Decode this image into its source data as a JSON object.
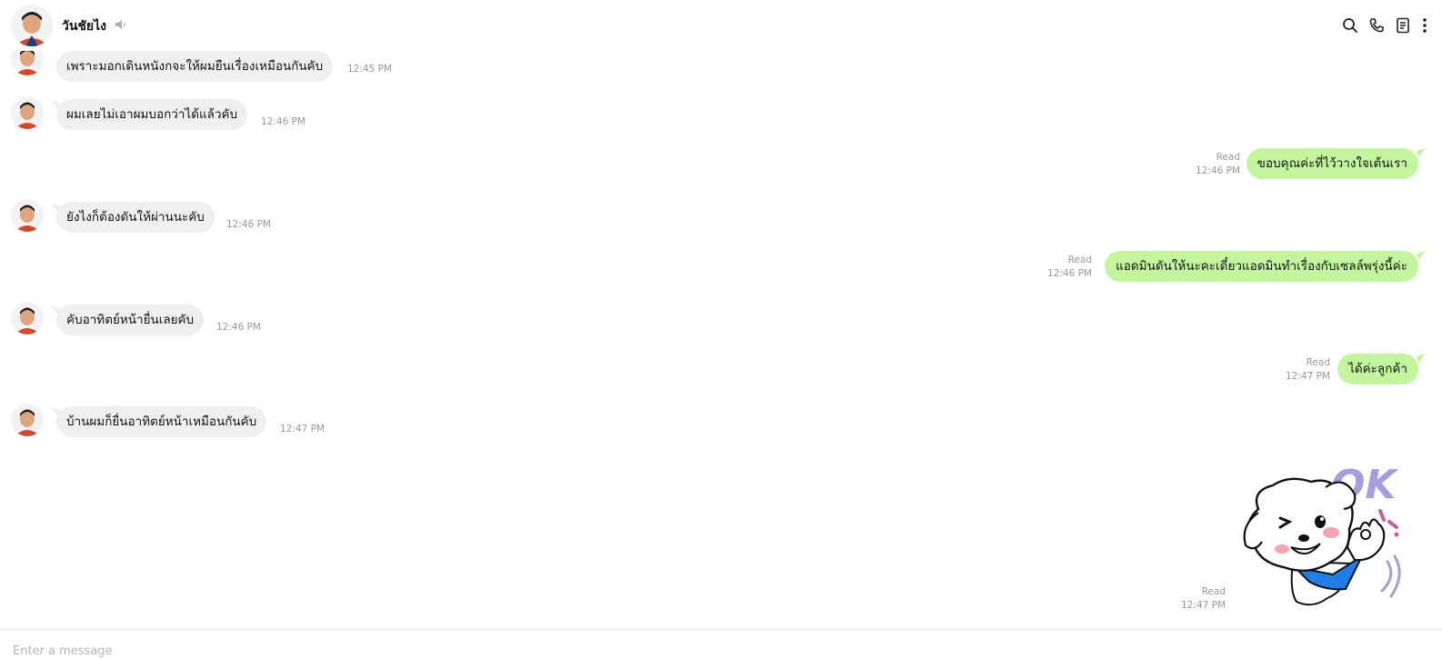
{
  "header": {
    "contact_name": "วันชัยไง",
    "icons": [
      "search-icon",
      "phone-icon",
      "notes-icon",
      "more-icon"
    ]
  },
  "messages": [
    {
      "side": "in",
      "text": "เพราะมอกเดินหนังกจะให้ผมยืนเรื่องเหมือนกันคับ",
      "time": "12:45 PM"
    },
    {
      "side": "in",
      "text": "ผมเลยไม่เอาผมบอกว่าได้แล้วคับ",
      "time": "12:46 PM"
    },
    {
      "side": "out",
      "text": "ขอบคุณค่ะที่ไว้วางใจเต้นเรา",
      "status": "Read",
      "time": "12:46 PM"
    },
    {
      "side": "in",
      "text": "ยังไงก็ต้องดันให้ผ่านนะคับ",
      "time": "12:46 PM"
    },
    {
      "side": "out",
      "text": "แอดมินดันให้นะคะเดี๋ยวแอดมินทำเรื่องกับเซลล์พรุ่งนี้ค่ะ",
      "status": "Read",
      "time": "12:46 PM"
    },
    {
      "side": "in",
      "text": "คับอาทิตย์หน้ายื่นเลยคับ",
      "time": "12:46 PM"
    },
    {
      "side": "out",
      "text": "ได้ค่ะลูกค้า",
      "status": "Read",
      "time": "12:47 PM"
    },
    {
      "side": "in",
      "text": "บ้านผมก็ยื่นอาทิตย์หน้าเหมือนกันคับ",
      "time": "12:47 PM"
    }
  ],
  "sticker": {
    "text": "OK",
    "status": "Read",
    "time": "12:47 PM"
  },
  "composer": {
    "placeholder": "Enter a message"
  },
  "colors": {
    "incoming_bubble": "#efefef",
    "outgoing_bubble": "#c3f69c",
    "meta_text": "#999999",
    "sticker_ok": "#a99be0",
    "sticker_scarf": "#1f7ee8"
  }
}
